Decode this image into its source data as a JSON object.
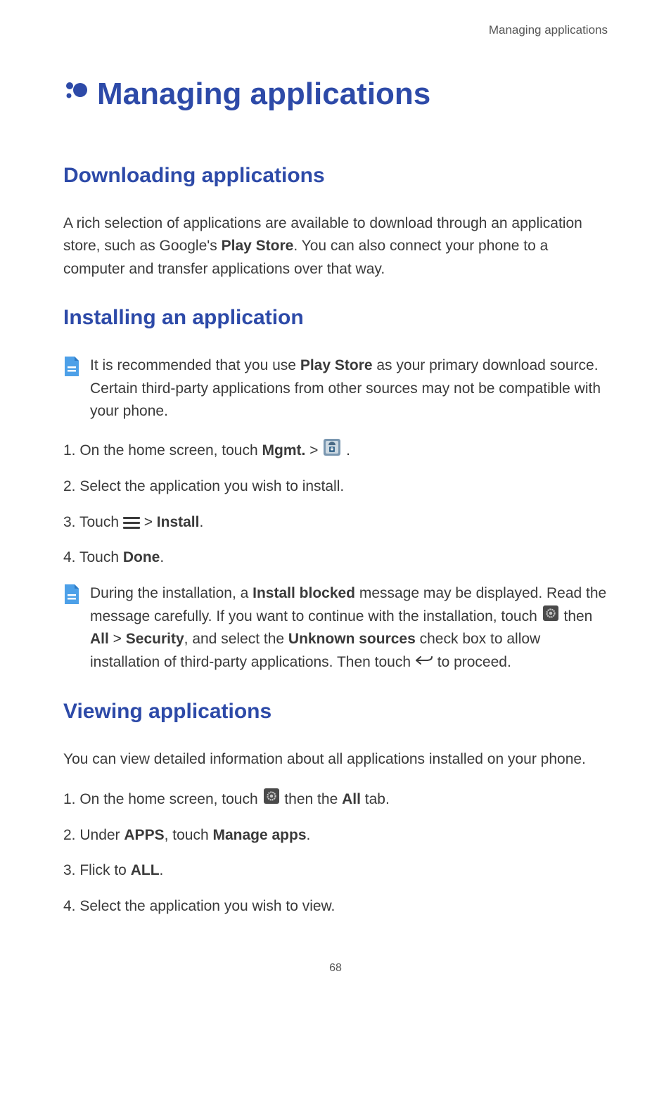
{
  "header": {
    "label": "Managing applications"
  },
  "title": "Managing applications",
  "sections": {
    "downloading": {
      "heading": "Downloading applications",
      "body_pre": "A rich selection of applications are available to download through an application store, such as Google's ",
      "body_bold": "Play Store",
      "body_post": ". You can also connect your phone to a computer and transfer applications over that way."
    },
    "installing": {
      "heading": "Installing an application",
      "note1_pre": "It is recommended that you use ",
      "note1_bold": "Play Store",
      "note1_post": " as your primary download source. Certain third-party applications from other sources may not be compatible with your phone.",
      "step1_pre": "1. On the home screen, touch ",
      "step1_bold": "Mgmt.",
      "step1_post": " > ",
      "step1_end": " .",
      "step2": "2. Select the application you wish to install.",
      "step3_pre": "3. Touch ",
      "step3_mid": " > ",
      "step3_bold": "Install",
      "step3_post": ".",
      "step4_pre": "4. Touch ",
      "step4_bold": "Done",
      "step4_post": ".",
      "note2_pre": "During the installation, a ",
      "note2_bold1": "Install blocked",
      "note2_mid1": " message may be displayed. Read the message carefully. If you want to continue with the installation, touch ",
      "note2_mid2": " then ",
      "note2_bold2": "All",
      "note2_mid3": " > ",
      "note2_bold3": "Security",
      "note2_mid4": ", and select the ",
      "note2_bold4": "Unknown sources",
      "note2_mid5": " check box to allow installation of third-party applications. Then touch ",
      "note2_post": " to proceed."
    },
    "viewing": {
      "heading": "Viewing applications",
      "body": "You can view detailed information about all applications installed on your phone.",
      "step1_pre": "1. On the home screen, touch ",
      "step1_mid": " then the ",
      "step1_bold": "All",
      "step1_post": " tab.",
      "step2_pre": "2. Under ",
      "step2_bold1": "APPS",
      "step2_mid": ", touch ",
      "step2_bold2": "Manage apps",
      "step2_post": ".",
      "step3_pre": "3. Flick to ",
      "step3_bold": "ALL",
      "step3_post": ".",
      "step4": "4. Select the application you wish to view."
    }
  },
  "page_number": "68"
}
